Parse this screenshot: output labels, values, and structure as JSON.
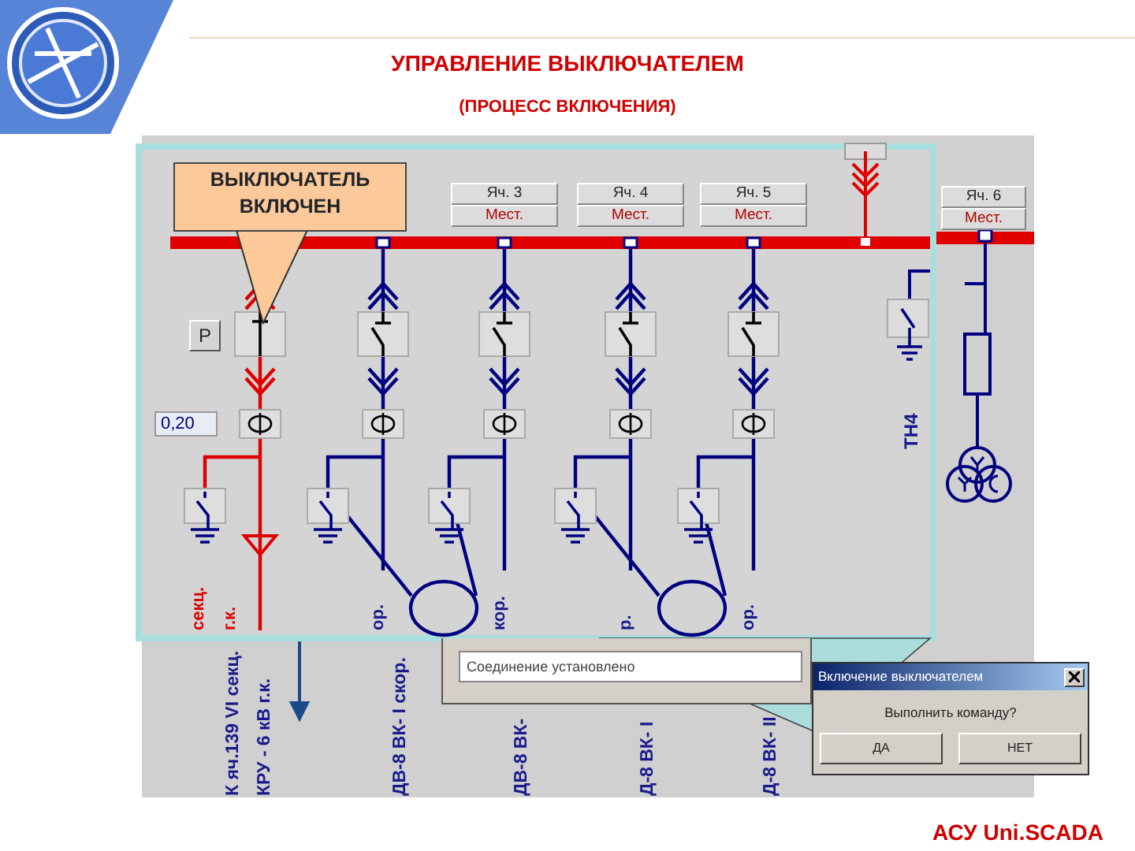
{
  "slide": {
    "title": "УПРАВЛЕНИЕ ВЫКЛЮЧАТЕЛЕМ",
    "subtitle": "(ПРОЦЕСС ВКЛЮЧЕНИЯ)",
    "footer": "АСУ Uni.SCADA"
  },
  "callout": "ВЫКЛЮЧАТЕЛЬ ВКЛЮЧЕН",
  "bus": {
    "energized": true
  },
  "incomer": {
    "energized": true
  },
  "reset_button": "Р",
  "reading": "0,20",
  "feeders": [
    {
      "kind": "cable",
      "energized": true,
      "breaker_closed": true,
      "tags": [
        "секц.",
        "г.к."
      ],
      "names": [
        "К яч.139 VI секц.",
        "КРУ - 6 кВ г.к."
      ]
    },
    {
      "kind": "motor",
      "energized": false,
      "breaker_closed": false,
      "tags": [
        "ор."
      ],
      "names": [
        "ДВ-8 ВК- I скор."
      ]
    },
    {
      "kind": "motor",
      "energized": false,
      "breaker_closed": false,
      "cell": {
        "name": "Яч. 3",
        "mode": "Мест."
      },
      "tags": [
        "кор."
      ],
      "names": [
        "ДВ-8 ВК-"
      ]
    },
    {
      "kind": "motor",
      "energized": false,
      "breaker_closed": false,
      "cell": {
        "name": "Яч. 4",
        "mode": "Мест."
      },
      "tags": [
        "р."
      ],
      "names": [
        "Д-8 ВК- I"
      ]
    },
    {
      "kind": "motor",
      "energized": false,
      "breaker_closed": false,
      "cell": {
        "name": "Яч. 5",
        "mode": "Мест."
      },
      "tags": [
        "ор."
      ],
      "names": [
        "Д-8 ВК- II"
      ]
    }
  ],
  "voltage_transformer": {
    "label": "ТН4"
  },
  "right_cell": {
    "name": "Яч. 6",
    "mode": "Мест."
  },
  "status_window": {
    "value": "Соединение установлено"
  },
  "dialog": {
    "title": "Включение выключателем",
    "message": "Выполнить команду?",
    "buttons": [
      "ДА",
      "НЕТ"
    ]
  }
}
